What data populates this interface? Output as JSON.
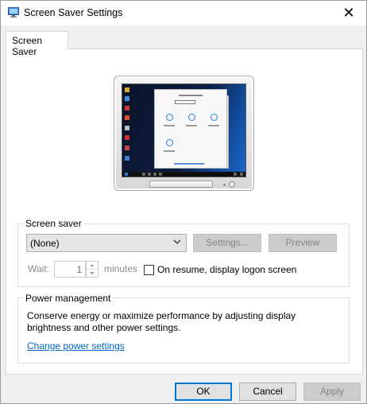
{
  "window": {
    "title": "Screen Saver Settings",
    "close_glyph": "✕"
  },
  "tab": {
    "label": "Screen Saver"
  },
  "screen_saver": {
    "group_label": "Screen saver",
    "selected_saver": "(None)",
    "settings_label": "Settings...",
    "preview_label": "Preview",
    "wait_label": "Wait:",
    "wait_value": "1",
    "minutes_label": "minutes",
    "resume_label": "On resume, display logon screen",
    "resume_checked": false
  },
  "power_management": {
    "group_label": "Power management",
    "description": "Conserve energy or maximize performance by adjusting display brightness and other power settings.",
    "link_label": "Change power settings"
  },
  "footer": {
    "ok_label": "OK",
    "cancel_label": "Cancel",
    "apply_label": "Apply"
  },
  "colors": {
    "accent": "#0078d7",
    "link": "#0066cc",
    "disabled_text": "#838383"
  }
}
